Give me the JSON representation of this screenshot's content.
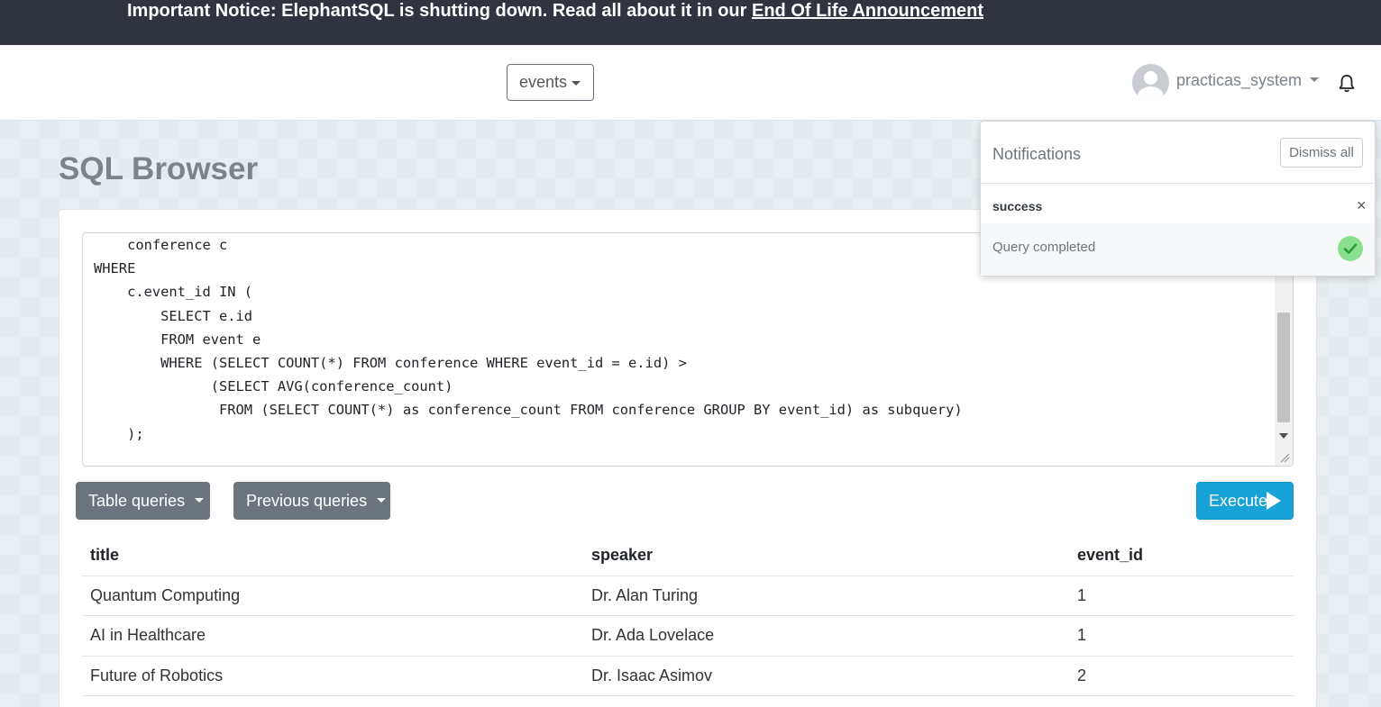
{
  "notice": {
    "text": "Important Notice: ElephantSQL is shutting down. Read all about it in our ",
    "link": "End Of Life Announcement"
  },
  "header": {
    "database": "events",
    "username": "practicas_system"
  },
  "page": {
    "title": "SQL Browser"
  },
  "editor": {
    "query": "    conference c\nWHERE\n    c.event_id IN (\n        SELECT e.id\n        FROM event e\n        WHERE (SELECT COUNT(*) FROM conference WHERE event_id = e.id) >\n              (SELECT AVG(conference_count)\n               FROM (SELECT COUNT(*) as conference_count FROM conference GROUP BY event_id) as subquery)\n    );"
  },
  "toolbar": {
    "table_queries": "Table queries",
    "previous_queries": "Previous queries",
    "execute": "Execute"
  },
  "results": {
    "columns": [
      "title",
      "speaker",
      "event_id"
    ],
    "rows": [
      [
        "Quantum Computing",
        "Dr. Alan Turing",
        "1"
      ],
      [
        "AI in Healthcare",
        "Dr. Ada Lovelace",
        "1"
      ],
      [
        "Future of Robotics",
        "Dr. Isaac Asimov",
        "2"
      ]
    ]
  },
  "notifications": {
    "title": "Notifications",
    "dismiss_all": "Dismiss all",
    "items": [
      {
        "type": "success",
        "message": "Query completed",
        "icon": "check-circle-icon",
        "color": "#8be08f"
      }
    ]
  },
  "colors": {
    "notice_bg": "#2f343e",
    "execute_bg": "#17a2d8",
    "secondary_btn": "#6c757d"
  }
}
